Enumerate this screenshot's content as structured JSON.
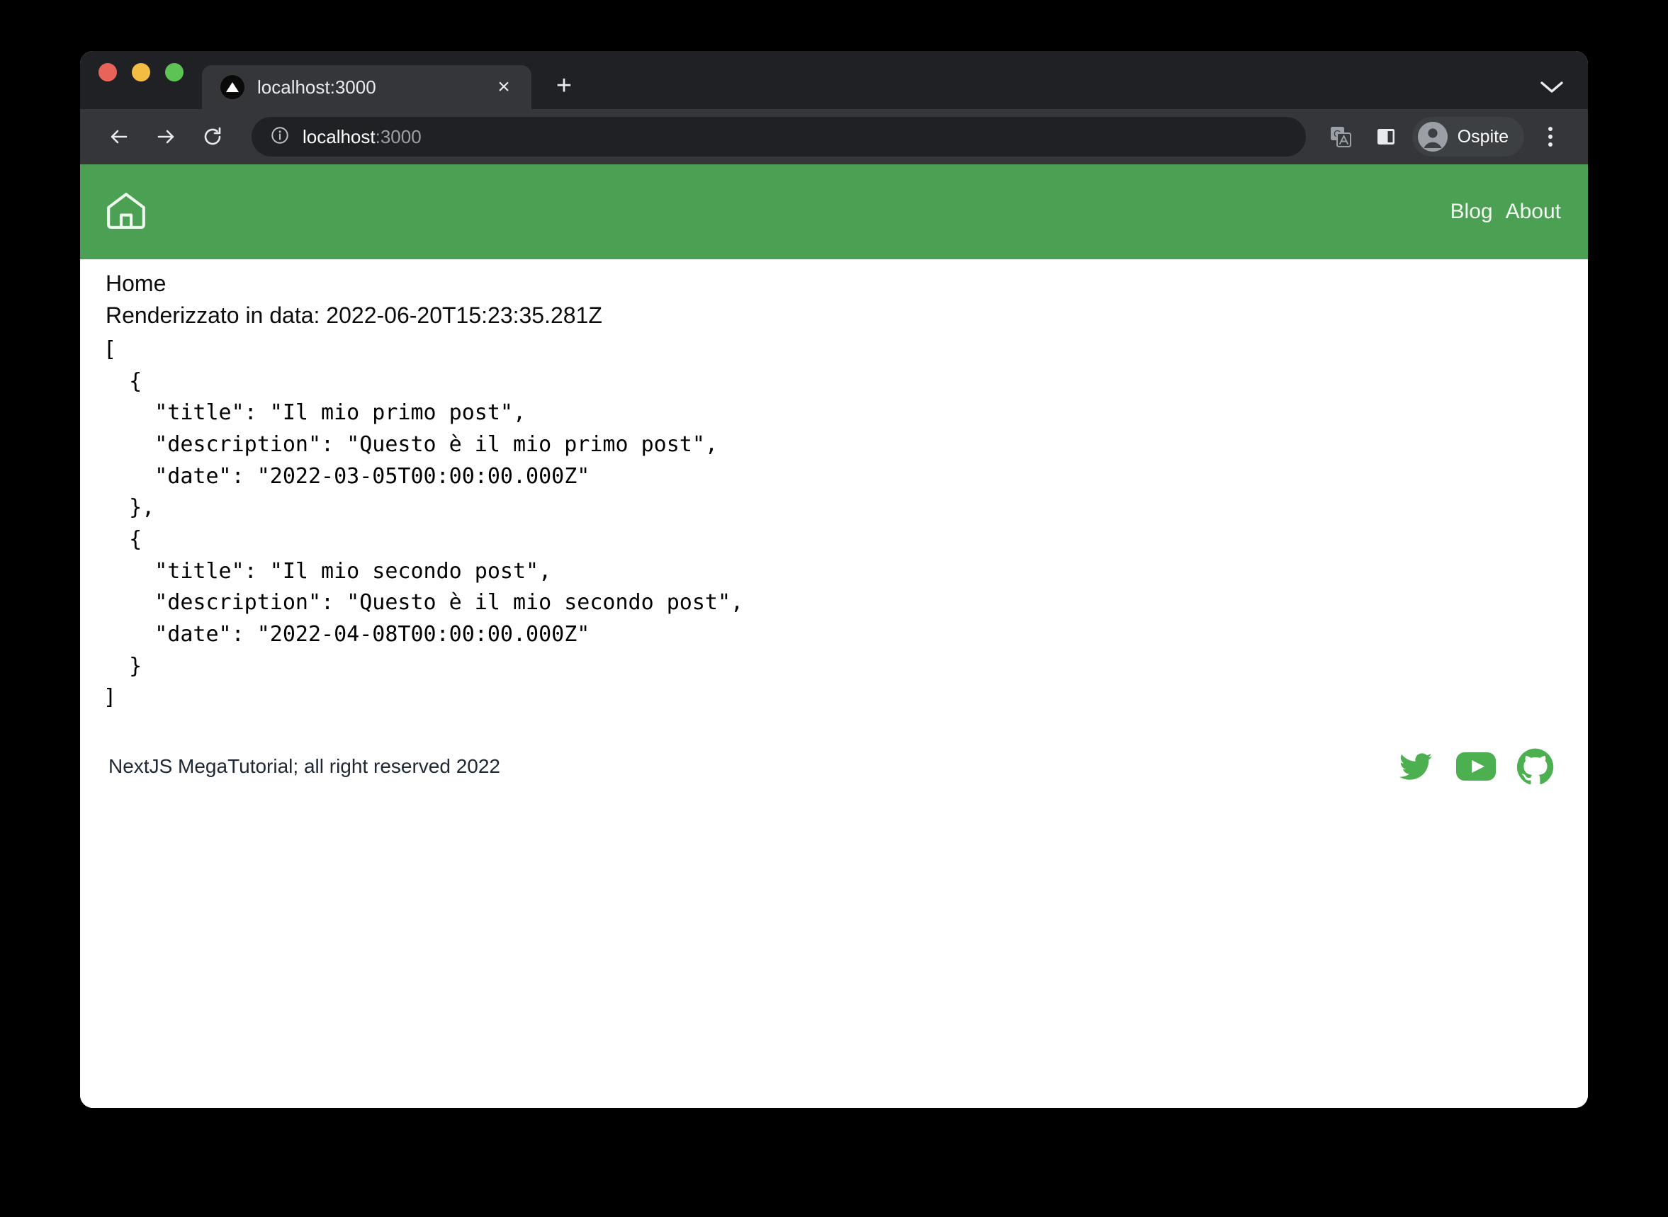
{
  "browser": {
    "traffic_lights": [
      {
        "name": "close",
        "color": "#e8645a"
      },
      {
        "name": "minimize",
        "color": "#f2bd42"
      },
      {
        "name": "maximize",
        "color": "#5dc354"
      }
    ],
    "tab": {
      "title": "localhost:3000",
      "favicon": "nextjs-triangle-icon",
      "close_label": "×"
    },
    "new_tab_label": "+",
    "tabstrip_chevron": "⌄",
    "toolbar": {
      "back_icon": "back-arrow-icon",
      "forward_icon": "forward-arrow-icon",
      "reload_icon": "reload-icon",
      "site_info_icon": "info-circle-icon",
      "url_host": "localhost",
      "url_port": ":3000",
      "translate_icon": "translate-icon",
      "side_panel_icon": "side-panel-icon",
      "profile_name": "Ospite",
      "menu_icon": "three-dot-menu-icon"
    }
  },
  "page": {
    "header": {
      "home_icon": "home-icon",
      "nav_links": [
        {
          "label": "Blog"
        },
        {
          "label": "About"
        }
      ],
      "background_color": "#4ca054"
    },
    "content": {
      "heading": "Home",
      "rendered_at": "Renderizzato in data: 2022-06-20T15:23:35.281Z",
      "json_dump": "[\n  {\n    \"title\": \"Il mio primo post\",\n    \"description\": \"Questo è il mio primo post\",\n    \"date\": \"2022-03-05T00:00:00.000Z\"\n  },\n  {\n    \"title\": \"Il mio secondo post\",\n    \"description\": \"Questo è il mio secondo post\",\n    \"date\": \"2022-04-08T00:00:00.000Z\"\n  }\n]",
      "posts": [
        {
          "title": "Il mio primo post",
          "description": "Questo è il mio primo post",
          "date": "2022-03-05T00:00:00.000Z"
        },
        {
          "title": "Il mio secondo post",
          "description": "Questo è il mio secondo post",
          "date": "2022-04-08T00:00:00.000Z"
        }
      ]
    },
    "footer": {
      "text": "NextJS MegaTutorial; all right reserved 2022",
      "social": [
        {
          "name": "twitter-icon"
        },
        {
          "name": "youtube-icon"
        },
        {
          "name": "github-icon"
        }
      ],
      "social_color": "#4caf50"
    }
  }
}
